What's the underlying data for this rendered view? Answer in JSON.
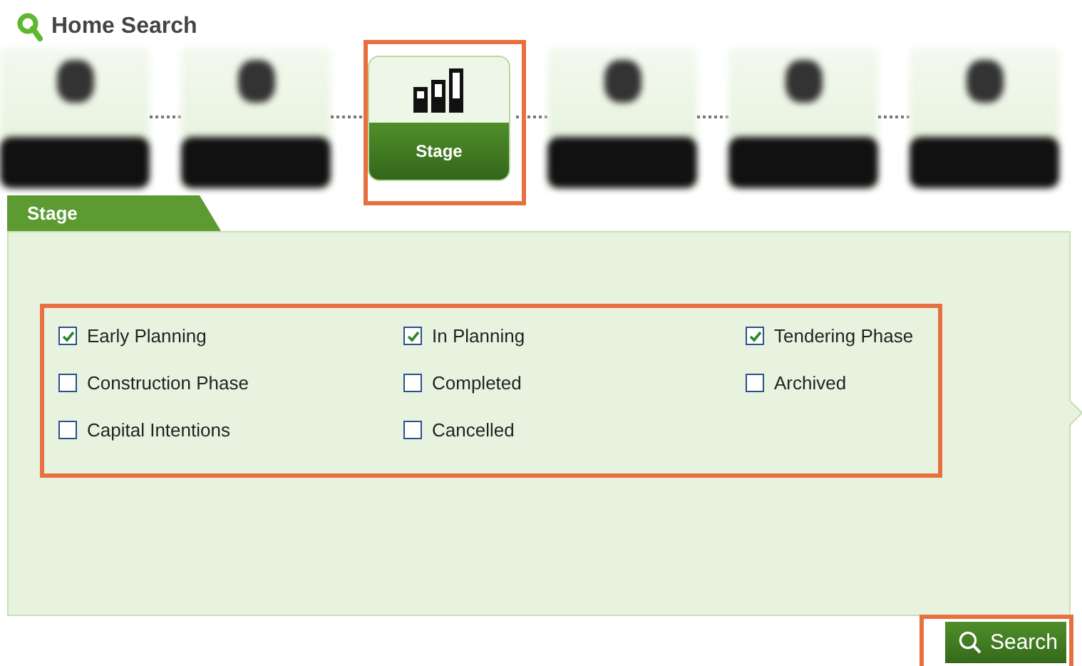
{
  "header": {
    "title": "Home Search"
  },
  "steps": [
    {
      "kind": "blurred",
      "selected": false
    },
    {
      "kind": "blurred",
      "selected": false
    },
    {
      "kind": "active",
      "label": "Stage",
      "selected": true
    },
    {
      "kind": "blurred",
      "selected": false
    },
    {
      "kind": "blurred",
      "selected": false
    },
    {
      "kind": "blurred",
      "selected": false
    }
  ],
  "section": {
    "tab": "Stage",
    "options": [
      {
        "label": "Early Planning",
        "checked": true
      },
      {
        "label": "In Planning",
        "checked": true
      },
      {
        "label": "Tendering Phase",
        "checked": true
      },
      {
        "label": "Construction Phase",
        "checked": false
      },
      {
        "label": "Completed",
        "checked": false
      },
      {
        "label": "Archived",
        "checked": false
      },
      {
        "label": "Capital Intentions",
        "checked": false
      },
      {
        "label": "Cancelled",
        "checked": false
      }
    ]
  },
  "search_button": {
    "label": "Search"
  }
}
